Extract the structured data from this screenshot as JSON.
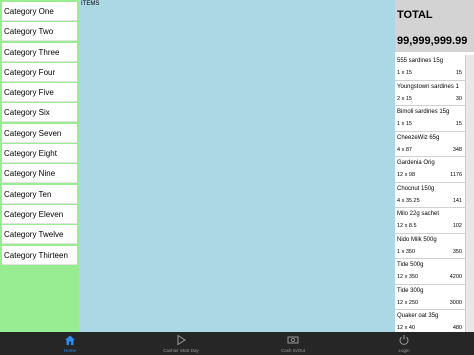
{
  "colors": {
    "category_panel": "#98ec91",
    "items_panel": "#acd8e6",
    "total_box": "#d3d3d3",
    "tabbar": "#262626",
    "tab_active": "#2e8bf0",
    "tab_inactive": "#9a9a9a"
  },
  "categories": [
    "Category One",
    "Category Two",
    "Category Three",
    "Category Four",
    "Category Five",
    "Category Six",
    "Category Seven",
    "Category Eight",
    "Category Nine",
    "Category Ten",
    "Category Eleven",
    "Category Twelve",
    "Category Thirteen"
  ],
  "items_panel": {
    "title": "ITEMS"
  },
  "total": {
    "label": "TOTAL",
    "value": "99,999,999.99"
  },
  "line_items": [
    {
      "name": "555 sardines 15g",
      "qty": "1 x 15",
      "amount": "15"
    },
    {
      "name": "Youngstown sardines 1",
      "qty": "2 x 15",
      "amount": "30"
    },
    {
      "name": "Bimoli sardines 15g",
      "qty": "1 x 15",
      "amount": "15"
    },
    {
      "name": "CheezeWiz 65g",
      "qty": "4 x 87",
      "amount": "348"
    },
    {
      "name": "Gardenia Orig",
      "qty": "12 x 98",
      "amount": "1176"
    },
    {
      "name": "Chocnut 150g",
      "qty": "4 x 35.25",
      "amount": "141"
    },
    {
      "name": "Milo 22g sachet",
      "qty": "12 x 8.5",
      "amount": "102"
    },
    {
      "name": "Nido Milk 500g",
      "qty": "1 x 350",
      "amount": "350"
    },
    {
      "name": "Tide 500g",
      "qty": "12 x 350",
      "amount": "4200"
    },
    {
      "name": "Tide 300g",
      "qty": "12 x 250",
      "amount": "3000"
    },
    {
      "name": "Quaker oat 35g",
      "qty": "12 x 40",
      "amount": "480"
    }
  ],
  "tabs": [
    {
      "label": "Home",
      "icon": "home-icon",
      "active": true
    },
    {
      "label": "Cashier Start Day",
      "icon": "play-icon",
      "active": false
    },
    {
      "label": "Cash In/Out",
      "icon": "cash-icon",
      "active": false
    },
    {
      "label": "Login",
      "icon": "power-icon",
      "active": false
    }
  ]
}
